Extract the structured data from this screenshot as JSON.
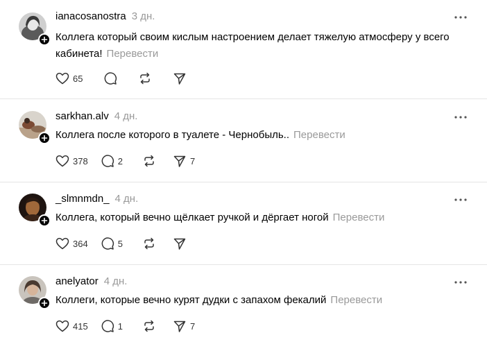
{
  "translate_label": "Перевести",
  "posts": [
    {
      "username": "ianacosanostra",
      "time": "3 дн.",
      "text": "Коллега который своим кислым настроением делает тяжелую атмосферу у всего кабинета!",
      "likes": "65",
      "replies": "",
      "reposts": "",
      "shares": ""
    },
    {
      "username": "sarkhan.alv",
      "time": "4 дн.",
      "text": "Коллега после которого в туалете - Чернобыль..",
      "likes": "378",
      "replies": "2",
      "reposts": "",
      "shares": "7"
    },
    {
      "username": "_slmnmdn_",
      "time": "4 дн.",
      "text": "Коллега, который вечно щёлкает ручкой и дёргает ногой",
      "likes": "364",
      "replies": "5",
      "reposts": "",
      "shares": ""
    },
    {
      "username": "anelyator",
      "time": "4 дн.",
      "text": "Коллеги, которые вечно курят дудки с запахом фекалий",
      "likes": "415",
      "replies": "1",
      "reposts": "",
      "shares": "7"
    }
  ],
  "icons": {
    "like": "heart-icon",
    "reply": "comment-icon",
    "repost": "repost-icon",
    "share": "send-icon",
    "more": "more-dots-icon",
    "follow": "plus-icon"
  }
}
